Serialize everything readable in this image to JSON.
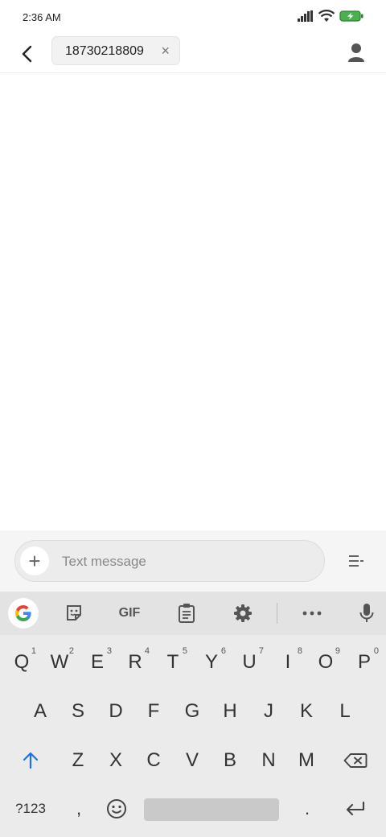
{
  "status_bar": {
    "time": "2:36 AM"
  },
  "header": {
    "recipient": "18730218809",
    "chip_remove": "×"
  },
  "compose": {
    "add_label": "+",
    "placeholder": "Text message"
  },
  "keyboard_toolbar": {
    "gif_label": "GIF"
  },
  "keyboard": {
    "row1": [
      {
        "key": "Q",
        "hint": "1"
      },
      {
        "key": "W",
        "hint": "2"
      },
      {
        "key": "E",
        "hint": "3"
      },
      {
        "key": "R",
        "hint": "4"
      },
      {
        "key": "T",
        "hint": "5"
      },
      {
        "key": "Y",
        "hint": "6"
      },
      {
        "key": "U",
        "hint": "7"
      },
      {
        "key": "I",
        "hint": "8"
      },
      {
        "key": "O",
        "hint": "9"
      },
      {
        "key": "P",
        "hint": "0"
      }
    ],
    "row2": [
      "A",
      "S",
      "D",
      "F",
      "G",
      "H",
      "J",
      "K",
      "L"
    ],
    "row3": [
      "Z",
      "X",
      "C",
      "V",
      "B",
      "N",
      "M"
    ],
    "symbols_label": "?123",
    "comma": ",",
    "period": "."
  },
  "colors": {
    "accent_blue": "#1a73e8",
    "battery_green": "#4caf50"
  }
}
